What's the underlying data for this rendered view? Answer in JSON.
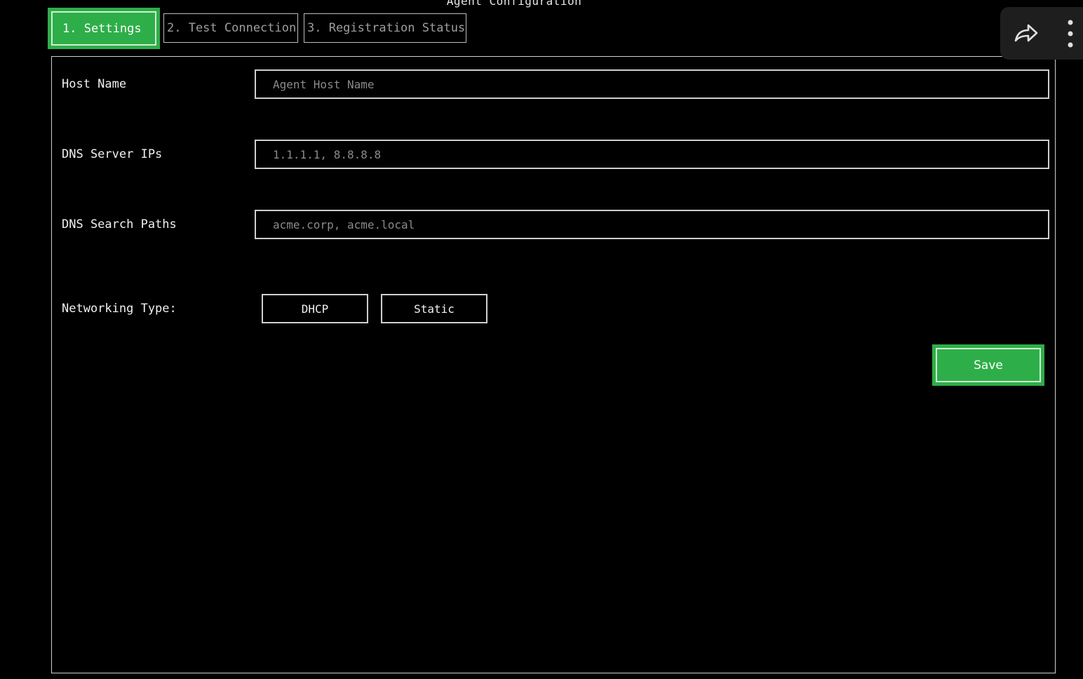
{
  "window": {
    "title": "Agent Configuration"
  },
  "tabs": [
    {
      "label": "1. Settings",
      "active": true
    },
    {
      "label": "2. Test Connection",
      "active": false
    },
    {
      "label": "3. Registration Status",
      "active": false
    }
  ],
  "form": {
    "host_name": {
      "label": "Host Name",
      "value": "",
      "placeholder": "Agent Host Name"
    },
    "dns_server_ips": {
      "label": "DNS Server IPs",
      "value": "",
      "placeholder": "1.1.1.1, 8.8.8.8"
    },
    "dns_search_paths": {
      "label": "DNS Search Paths",
      "value": "",
      "placeholder": "acme.corp, acme.local"
    },
    "networking_type": {
      "label": "Networking Type:",
      "options": [
        "DHCP",
        "Static"
      ]
    }
  },
  "actions": {
    "save_label": "Save"
  },
  "toolbar": {
    "share_icon": "share-forward-icon",
    "menu_icon": "more-vert-icon"
  },
  "colors": {
    "accent": "#2eae48",
    "background": "#000000",
    "text": "#f0f0f0",
    "placeholder": "#8a8a8a"
  }
}
